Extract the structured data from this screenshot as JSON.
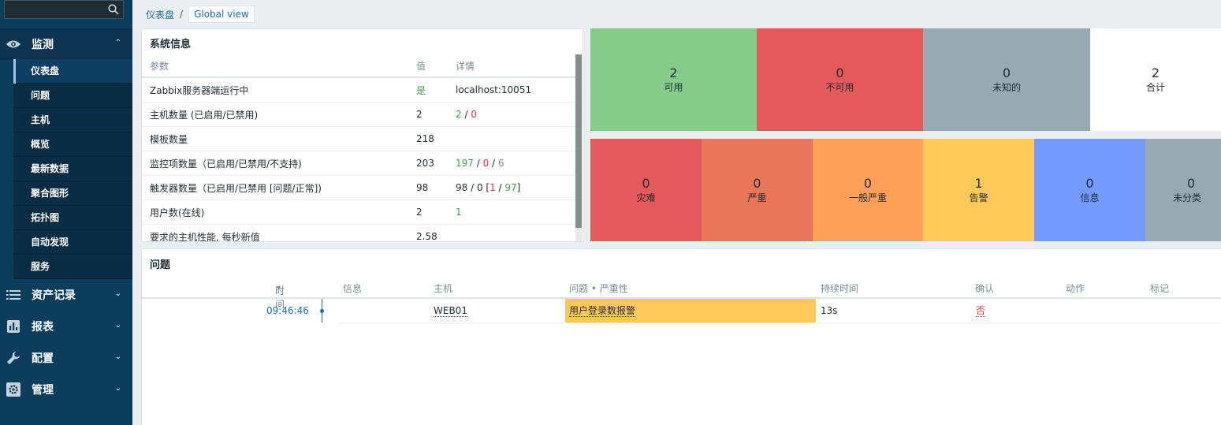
{
  "sidebar": {
    "search_placeholder": "",
    "sections": [
      {
        "label": "监测",
        "icon": "eye-icon"
      },
      {
        "label": "资产记录",
        "icon": "list-icon"
      },
      {
        "label": "报表",
        "icon": "bar-chart-icon"
      },
      {
        "label": "配置",
        "icon": "wrench-icon"
      },
      {
        "label": "管理",
        "icon": "gear-icon"
      }
    ],
    "monitoring_items": [
      "仪表盘",
      "问题",
      "主机",
      "概览",
      "最新数据",
      "聚合图形",
      "拓扑图",
      "自动发现",
      "服务"
    ]
  },
  "breadcrumb": {
    "root": "仪表盘",
    "separator": "/",
    "current": "Global view"
  },
  "system_info": {
    "title": "系统信息",
    "headers": {
      "param": "参数",
      "value": "值",
      "detail": "详情"
    },
    "rows": [
      {
        "param": "Zabbix服务器端运行中",
        "value": "是",
        "detail": "localhost:10051"
      },
      {
        "param": "主机数量 (已启用/已禁用)",
        "value": "2",
        "d1": "2",
        "s1": " / ",
        "d2": "0"
      },
      {
        "param": "模板数量",
        "value": "218"
      },
      {
        "param": "监控项数量（已启用/已禁用/不支持)",
        "value": "203",
        "d1": "197",
        "s1": " / ",
        "d2": "0",
        "s2": " / ",
        "d3": "6"
      },
      {
        "param": "触发器数量（已启用/已禁用 [问题/正常])",
        "value": "98",
        "d0": "98 / 0 [",
        "d1": "1",
        "s1": " / ",
        "d2": "97",
        "d3": "]"
      },
      {
        "param": "用户数(在线)",
        "value": "2",
        "d1": "1"
      },
      {
        "param": "要求的主机性能, 每秒新值",
        "value": "2.58"
      }
    ]
  },
  "host_availability": [
    {
      "count": "2",
      "label": "可用",
      "color": "#86cb89"
    },
    {
      "count": "0",
      "label": "不可用",
      "color": "#e45959"
    },
    {
      "count": "0",
      "label": "未知的",
      "color": "#97aab3"
    },
    {
      "count": "2",
      "label": "合计",
      "color": "#ffffff"
    }
  ],
  "problem_severity": [
    {
      "count": "0",
      "label": "灾难",
      "color": "#e45959"
    },
    {
      "count": "0",
      "label": "严重",
      "color": "#e97659"
    },
    {
      "count": "0",
      "label": "一般严重",
      "color": "#ffa059"
    },
    {
      "count": "1",
      "label": "告警",
      "color": "#ffc859"
    },
    {
      "count": "0",
      "label": "信息",
      "color": "#7499ff"
    },
    {
      "count": "0",
      "label": "未分类",
      "color": "#97aab3"
    }
  ],
  "problems": {
    "title": "问题",
    "headers": {
      "time": "时间",
      "sort_arrow": "▾",
      "info": "信息",
      "host": "主机",
      "problem": "问题 • 严重性",
      "duration": "持续时间",
      "ack": "确认",
      "actions": "动作",
      "tags": "标记"
    },
    "rows": [
      {
        "time": "09:46:46",
        "host": "WEB01",
        "problem": "用户登录数报警",
        "duration": "13s",
        "ack": "否",
        "severity_color": "#ffc859"
      }
    ]
  }
}
